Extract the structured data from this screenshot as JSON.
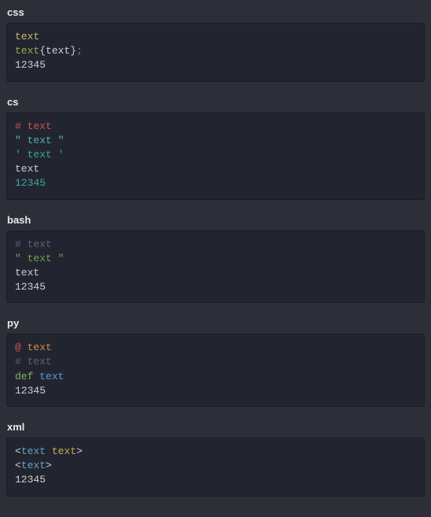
{
  "blocks": [
    {
      "lang": "css",
      "lines": [
        [
          {
            "t": "text",
            "c": "yellow"
          }
        ],
        [
          {
            "t": "text",
            "c": "olive"
          },
          {
            "t": "{",
            "c": "plain"
          },
          {
            "t": "text",
            "c": "plain"
          },
          {
            "t": "}",
            "c": "plain"
          },
          {
            "t": ";",
            "c": "gray"
          }
        ],
        [
          {
            "t": "12345",
            "c": "plain"
          }
        ]
      ]
    },
    {
      "lang": "cs",
      "lines": [
        [
          {
            "t": "# text",
            "c": "red"
          }
        ],
        [
          {
            "t": "\" text \"",
            "c": "cyan"
          }
        ],
        [
          {
            "t": "' text '",
            "c": "teal"
          }
        ],
        [
          {
            "t": "text",
            "c": "plain"
          }
        ],
        [
          {
            "t": "12345",
            "c": "teal"
          }
        ]
      ]
    },
    {
      "lang": "bash",
      "lines": [
        [
          {
            "t": "# text",
            "c": "dim"
          }
        ],
        [
          {
            "t": "\" text \"",
            "c": "green"
          }
        ],
        [
          {
            "t": "text",
            "c": "plain"
          }
        ],
        [
          {
            "t": "12345",
            "c": "plain"
          }
        ]
      ]
    },
    {
      "lang": "py",
      "lines": [
        [
          {
            "t": "@",
            "c": "red"
          },
          {
            "t": " ",
            "c": "plain"
          },
          {
            "t": "text",
            "c": "orange"
          }
        ],
        [
          {
            "t": "# text",
            "c": "dim"
          }
        ],
        [
          {
            "t": "def",
            "c": "greenb"
          },
          {
            "t": " ",
            "c": "plain"
          },
          {
            "t": "text",
            "c": "blue"
          }
        ],
        [
          {
            "t": "12345",
            "c": "plain"
          }
        ]
      ]
    },
    {
      "lang": "xml",
      "lines": [
        [
          {
            "t": "<",
            "c": "plain"
          },
          {
            "t": "text",
            "c": "blue2"
          },
          {
            "t": " ",
            "c": "plain"
          },
          {
            "t": "text",
            "c": "yel2"
          },
          {
            "t": ">",
            "c": "plain"
          }
        ],
        [
          {
            "t": "<",
            "c": "plain"
          },
          {
            "t": "text",
            "c": "blue2"
          },
          {
            "t": ">",
            "c": "plain"
          }
        ],
        [
          {
            "t": "12345",
            "c": "plain"
          }
        ]
      ]
    }
  ]
}
